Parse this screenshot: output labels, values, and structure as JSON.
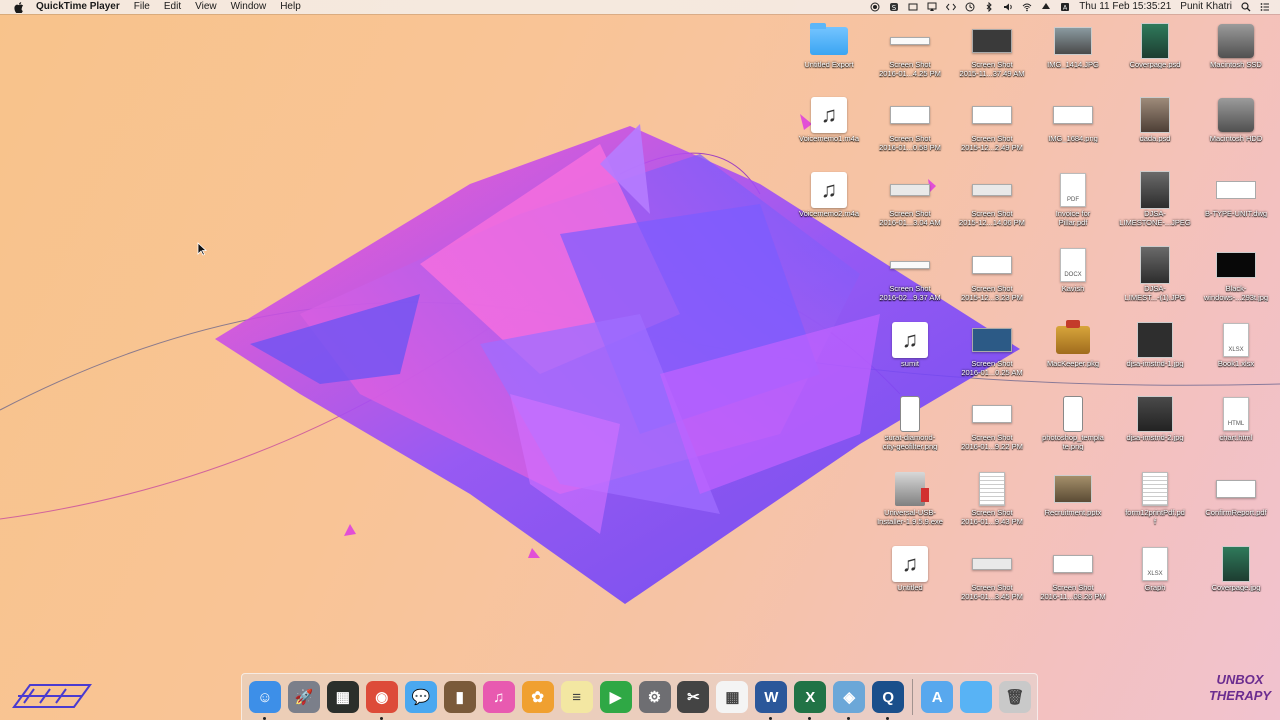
{
  "menubar": {
    "app_name": "QuickTime Player",
    "menus": [
      "File",
      "Edit",
      "View",
      "Window",
      "Help"
    ],
    "clock": "Thu 11 Feb  15:35:21",
    "user": "Punit Khatri"
  },
  "desktop_icons": [
    {
      "label": "Untitled Export",
      "kind": "folder"
    },
    {
      "label": "Screen Shot\n2016-01...4.25 PM",
      "kind": "shot-line"
    },
    {
      "label": "Screen Shot\n2015-11...37.49 AM",
      "kind": "shot-dark"
    },
    {
      "label": "IMG_1414.JPG",
      "kind": "photo-pic"
    },
    {
      "label": "Coverpage.psd",
      "kind": "photo-green"
    },
    {
      "label": "Macintosh SSD",
      "kind": "disk"
    },
    {
      "label": "Voicememo1.m4a",
      "kind": "music"
    },
    {
      "label": "Screen Shot\n2016-01...0.58 PM",
      "kind": "shot"
    },
    {
      "label": "Screen Shot\n2015-12...2.49 PM",
      "kind": "shot-wide"
    },
    {
      "label": "IMG_1684.png",
      "kind": "shot-wide"
    },
    {
      "label": "dada.psd",
      "kind": "photo-person"
    },
    {
      "label": "Macintosh HDD",
      "kind": "disk"
    },
    {
      "label": "Voicememo2.m4a",
      "kind": "music"
    },
    {
      "label": "Screen Shot\n2016-01...3.04 AM",
      "kind": "shot-bar"
    },
    {
      "label": "Screen Shot\n2015-12...14.06 PM",
      "kind": "shot-bar"
    },
    {
      "label": "Invoice for\nPillar.pdf",
      "kind": "doc-pdf"
    },
    {
      "label": "DJSA-\nLIMESTONE-...JPEG",
      "kind": "photo-tall"
    },
    {
      "label": "B-TYPE-UNIT.dwg",
      "kind": "dwg"
    },
    {
      "label": "Screen Shot\n2016-02...9.37 AM",
      "kind": "shot-line"
    },
    {
      "label": "Screen Shot\n2015-12...3.23 PM",
      "kind": "shot"
    },
    {
      "label": "Kavish",
      "kind": "doc-docx"
    },
    {
      "label": "DJSA-\nLIMEST...-(1).JPG",
      "kind": "photo-tall"
    },
    {
      "label": "Black-\nwindows-...293t.jpg",
      "kind": "photo-black"
    },
    {
      "label": "sumit",
      "kind": "music"
    },
    {
      "label": "Screen Shot\n2016-01...0.25 AM",
      "kind": "shot-blue"
    },
    {
      "label": "MacKeeper.pkg",
      "kind": "box"
    },
    {
      "label": "djsa-imstnd-1.jpg",
      "kind": "photo-square"
    },
    {
      "label": "Book1.xlsx",
      "kind": "doc-xlsx"
    },
    {
      "label": "surat-diamond-\ncity-geofilter.png",
      "kind": "phone"
    },
    {
      "label": "Screen Shot\n2016-01...9.22 PM",
      "kind": "shot"
    },
    {
      "label": "photoshop_templa\nte.png",
      "kind": "phone"
    },
    {
      "label": "djsa-imstnd-2.jpg",
      "kind": "photo-darksq"
    },
    {
      "label": "chart.html",
      "kind": "doc-html"
    },
    {
      "label": "Universal-USB-\nInstaller-1.9.5.9.exe",
      "kind": "usb"
    },
    {
      "label": "Screen Shot\n2016-01...9.43 PM",
      "kind": "doc-striped"
    },
    {
      "label": "Recruitment.pptx",
      "kind": "photo-brown"
    },
    {
      "label": "form12printPdf.pd\nf",
      "kind": "doc-striped"
    },
    {
      "label": "ConfirmReport.pdf",
      "kind": "shot-wide"
    },
    {
      "label": "Untitled",
      "kind": "music"
    },
    {
      "label": "Screen Shot\n2016-01...3.45 PM",
      "kind": "shot-bar"
    },
    {
      "label": "Screen Shot\n2016-11...08.26 PM",
      "kind": "shot-wide"
    },
    {
      "label": "Graph",
      "kind": "doc-xlsx"
    },
    {
      "label": "Coverpage.jpg",
      "kind": "photo-green"
    }
  ],
  "dock": {
    "apps": [
      {
        "name": "Finder",
        "icon": "finder-icon",
        "color": "#3d8fe8",
        "glyph": "☺",
        "running": true
      },
      {
        "name": "Launchpad",
        "icon": "launchpad-icon",
        "color": "#7b7f8a",
        "glyph": "🚀",
        "running": false
      },
      {
        "name": "Mission Control",
        "icon": "mission-control-icon",
        "color": "#2b2f2b",
        "glyph": "▦",
        "running": false
      },
      {
        "name": "Chrome",
        "icon": "chrome-icon",
        "color": "#dd4b39",
        "glyph": "◉",
        "running": true
      },
      {
        "name": "Messages",
        "icon": "messages-icon",
        "color": "#4aa8f0",
        "glyph": "💬",
        "running": false
      },
      {
        "name": "Notefile",
        "icon": "notebook-icon",
        "color": "#7a5a3a",
        "glyph": "▮",
        "running": false
      },
      {
        "name": "iTunes",
        "icon": "itunes-icon",
        "color": "#e85ab0",
        "glyph": "♫",
        "running": false
      },
      {
        "name": "Photos",
        "icon": "photos-icon",
        "color": "#f0a030",
        "glyph": "✿",
        "running": false
      },
      {
        "name": "Notes",
        "icon": "notes-icon",
        "color": "#f3e7a2",
        "glyph": "≡",
        "running": false
      },
      {
        "name": "FaceTime",
        "icon": "facetime-icon",
        "color": "#2fa845",
        "glyph": "▶",
        "running": false
      },
      {
        "name": "System Preferences",
        "icon": "gear-icon",
        "color": "#6e6e72",
        "glyph": "⚙",
        "running": false
      },
      {
        "name": "Final Cut",
        "icon": "clapper-icon",
        "color": "#444",
        "glyph": "✂",
        "running": false
      },
      {
        "name": "Microsoft Office",
        "icon": "office-grid-icon",
        "color": "#f4f4f4",
        "glyph": "▦",
        "running": false
      },
      {
        "name": "Word",
        "icon": "word-icon",
        "color": "#2b579a",
        "glyph": "W",
        "running": true
      },
      {
        "name": "Excel",
        "icon": "excel-icon",
        "color": "#217346",
        "glyph": "X",
        "running": true
      },
      {
        "name": "Preview",
        "icon": "preview-icon",
        "color": "#6ba7d8",
        "glyph": "◈",
        "running": true
      },
      {
        "name": "QuickTime Player",
        "icon": "quicktime-icon",
        "color": "#1a4f8b",
        "glyph": "Q",
        "running": true
      }
    ],
    "stacks": [
      {
        "name": "Applications",
        "icon": "applications-folder-icon",
        "color": "#58a8ee",
        "glyph": "A"
      },
      {
        "name": "Downloads",
        "icon": "folder-icon",
        "color": "#58b3f5",
        "glyph": ""
      },
      {
        "name": "Trash",
        "icon": "trash-icon",
        "color": "#c9c9c9",
        "glyph": "🗑"
      }
    ]
  },
  "watermark": {
    "right_text_line1": "UNBOX",
    "right_text_line2": "THERAPY"
  }
}
